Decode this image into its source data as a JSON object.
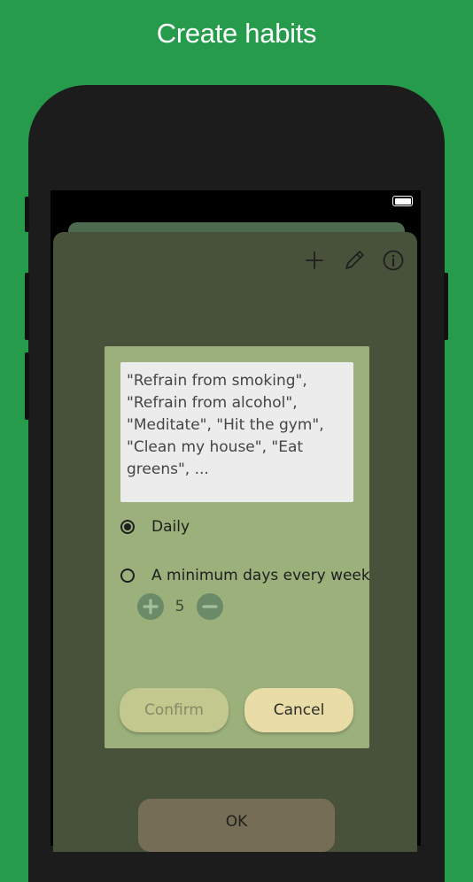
{
  "promo": {
    "headline": "Create habits"
  },
  "icons": {
    "battery": "battery-icon",
    "add": "plus-icon",
    "edit": "pencil-icon",
    "info": "info-icon",
    "increment": "plus-circle-icon",
    "decrement": "minus-circle-icon"
  },
  "colors": {
    "background": "#259b4b",
    "sheet": "#48523b",
    "dialog": "#9bb07b",
    "confirm": "#c2c88e",
    "cancel": "#eadca6",
    "ok": "#756d56",
    "stepper": "#6a8a68"
  },
  "dialog": {
    "habit_input_value": "\"Refrain from smoking\",\n\"Refrain from alcohol\",\n\"Meditate\", \"Hit the gym\",\n\"Clean my house\", \"Eat\ngreens\", ...",
    "frequency_options": [
      {
        "label": "Daily",
        "selected": true
      },
      {
        "label": "A minimum days every week",
        "selected": false
      }
    ],
    "min_days_value": "5",
    "confirm_label": "Confirm",
    "cancel_label": "Cancel"
  },
  "sheet": {
    "ok_label": "OK"
  }
}
